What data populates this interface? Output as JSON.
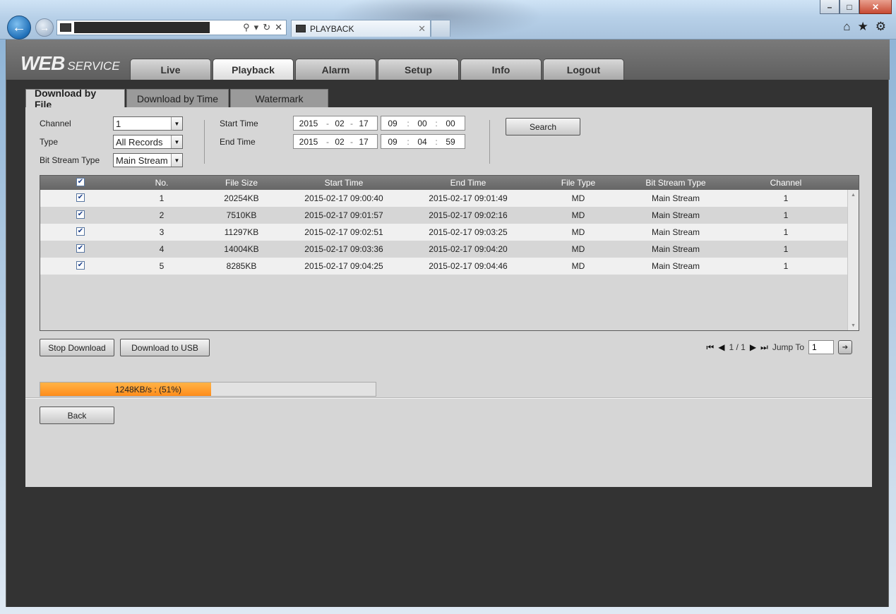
{
  "browser": {
    "tab_title": "PLAYBACK",
    "address_icons": [
      "search-icon",
      "dropdown-icon",
      "refresh-icon",
      "stop-icon"
    ],
    "toolbar_icons": [
      "home-icon",
      "star-icon",
      "gear-icon"
    ]
  },
  "app": {
    "logo_main": "WEB",
    "logo_sub": "SERVICE",
    "main_tabs": [
      {
        "label": "Live",
        "active": false
      },
      {
        "label": "Playback",
        "active": true
      },
      {
        "label": "Alarm",
        "active": false
      },
      {
        "label": "Setup",
        "active": false
      },
      {
        "label": "Info",
        "active": false
      },
      {
        "label": "Logout",
        "active": false
      }
    ],
    "sub_tabs": [
      {
        "label": "Download by File",
        "active": true
      },
      {
        "label": "Download by Time",
        "active": false
      },
      {
        "label": "Watermark",
        "active": false
      }
    ]
  },
  "form": {
    "channel_label": "Channel",
    "channel_value": "1",
    "type_label": "Type",
    "type_value": "All Records",
    "bitstream_label": "Bit Stream Type",
    "bitstream_value": "Main Stream",
    "start_label": "Start Time",
    "start": {
      "year": "2015",
      "month": "02",
      "day": "17",
      "hour": "09",
      "minute": "00",
      "second": "00"
    },
    "end_label": "End Time",
    "end": {
      "year": "2015",
      "month": "02",
      "day": "17",
      "hour": "09",
      "minute": "04",
      "second": "59"
    },
    "search_label": "Search"
  },
  "table": {
    "headers": {
      "no": "No.",
      "size": "File Size",
      "start": "Start Time",
      "end": "End Time",
      "ftype": "File Type",
      "bst": "Bit Stream Type",
      "ch": "Channel"
    },
    "rows": [
      {
        "no": "1",
        "size": "20254KB",
        "start": "2015-02-17 09:00:40",
        "end": "2015-02-17 09:01:49",
        "ftype": "MD",
        "bst": "Main Stream",
        "ch": "1",
        "checked": true
      },
      {
        "no": "2",
        "size": "7510KB",
        "start": "2015-02-17 09:01:57",
        "end": "2015-02-17 09:02:16",
        "ftype": "MD",
        "bst": "Main Stream",
        "ch": "1",
        "checked": true
      },
      {
        "no": "3",
        "size": "11297KB",
        "start": "2015-02-17 09:02:51",
        "end": "2015-02-17 09:03:25",
        "ftype": "MD",
        "bst": "Main Stream",
        "ch": "1",
        "checked": true
      },
      {
        "no": "4",
        "size": "14004KB",
        "start": "2015-02-17 09:03:36",
        "end": "2015-02-17 09:04:20",
        "ftype": "MD",
        "bst": "Main Stream",
        "ch": "1",
        "checked": true
      },
      {
        "no": "5",
        "size": "8285KB",
        "start": "2015-02-17 09:04:25",
        "end": "2015-02-17 09:04:46",
        "ftype": "MD",
        "bst": "Main Stream",
        "ch": "1",
        "checked": true
      }
    ]
  },
  "actions": {
    "stop_download": "Stop Download",
    "download_usb": "Download to USB",
    "back": "Back"
  },
  "pager": {
    "page_text": "1 / 1",
    "jump_label": "Jump To",
    "jump_value": "1"
  },
  "progress": {
    "text": "1248KB/s : (51%)",
    "fraction": 0.51,
    "color": "#ff8c1a"
  }
}
